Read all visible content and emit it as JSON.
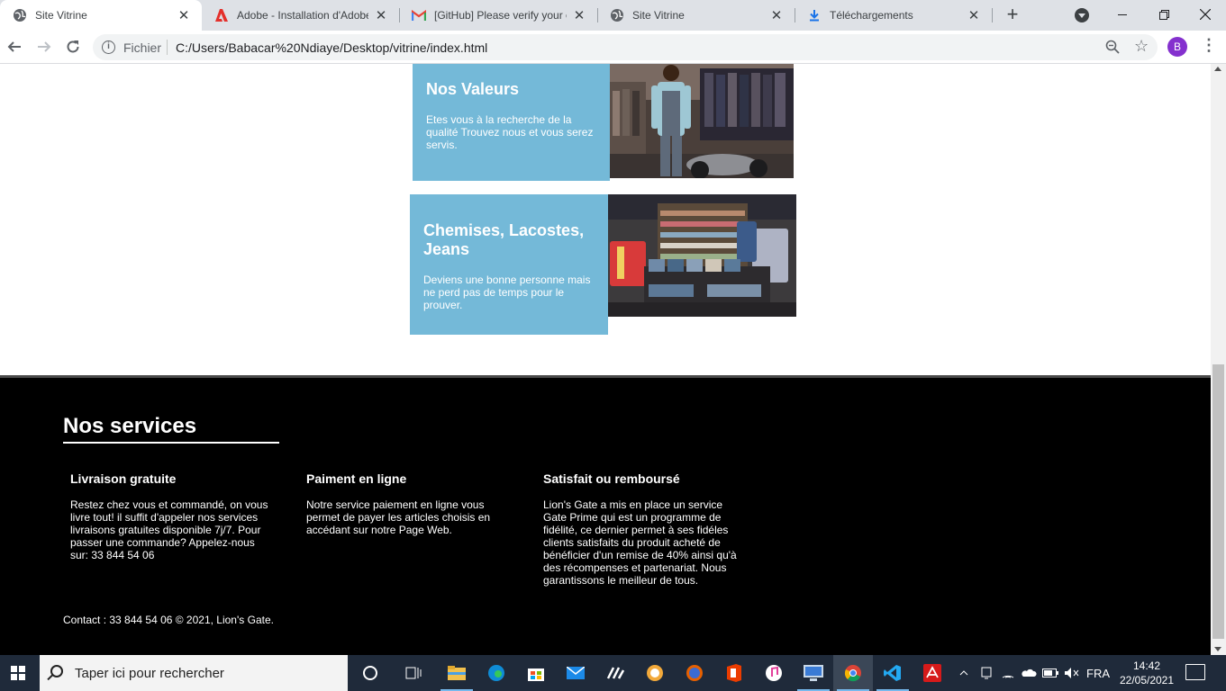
{
  "browser": {
    "tabs": [
      {
        "title": "Site Vitrine",
        "icon": "globe-icon",
        "active": true
      },
      {
        "title": "Adobe - Installation d'Adobe",
        "icon": "adobe-icon",
        "active": false
      },
      {
        "title": "[GitHub] Please verify your em",
        "icon": "gmail-icon",
        "active": false
      },
      {
        "title": "Site Vitrine",
        "icon": "globe-icon",
        "active": false
      },
      {
        "title": "Téléchargements",
        "icon": "download-icon",
        "active": false
      }
    ],
    "address": {
      "label": "Fichier",
      "url": "C:/Users/Babacar%20Ndiaye/Desktop/vitrine/index.html"
    },
    "profile_initial": "B"
  },
  "page": {
    "cards": [
      {
        "title": "Nos Valeurs",
        "text": "Etes vous à la recherche de la qualité Trouvez nous et vous serez servis."
      },
      {
        "title": "Chemises, Lacostes, Jeans",
        "text": "Deviens une bonne personne mais ne perd pas de temps pour le prouver."
      }
    ],
    "footer": {
      "title": "Nos services",
      "services": [
        {
          "title": "Livraison gratuite",
          "text": "Restez chez vous et commandé, on vous livre tout! il suffit d'appeler nos services livraisons gratuites disponible 7j/7. Pour passer une commande? Appelez-nous sur: 33 844 54 06"
        },
        {
          "title": "Paiment en ligne",
          "text": "Notre service paiement en ligne vous permet de payer les articles choisis en accédant sur notre Page Web."
        },
        {
          "title": "Satisfait ou remboursé",
          "text": "Lion's Gate a mis en place un service Gate Prime qui est un programme de fidélité, ce dernier permet à ses fidéles clients satisfaits du produit acheté de bénéficier d'un remise de 40% ainsi qu'à des récompenses et partenariat. Nous garantissons le meilleur de tous."
        }
      ],
      "contact": "Contact : 33 844 54 06 © 2021, Lion's Gate."
    }
  },
  "taskbar": {
    "search_placeholder": "Taper ici pour rechercher",
    "language": "FRA",
    "time": "14:42",
    "date": "22/05/2021"
  },
  "colors": {
    "card_blue": "#74b9d8",
    "footer_bg": "#000000",
    "tabstrip_bg": "#dee1e6",
    "taskbar_bg": "#1f2a3a"
  }
}
